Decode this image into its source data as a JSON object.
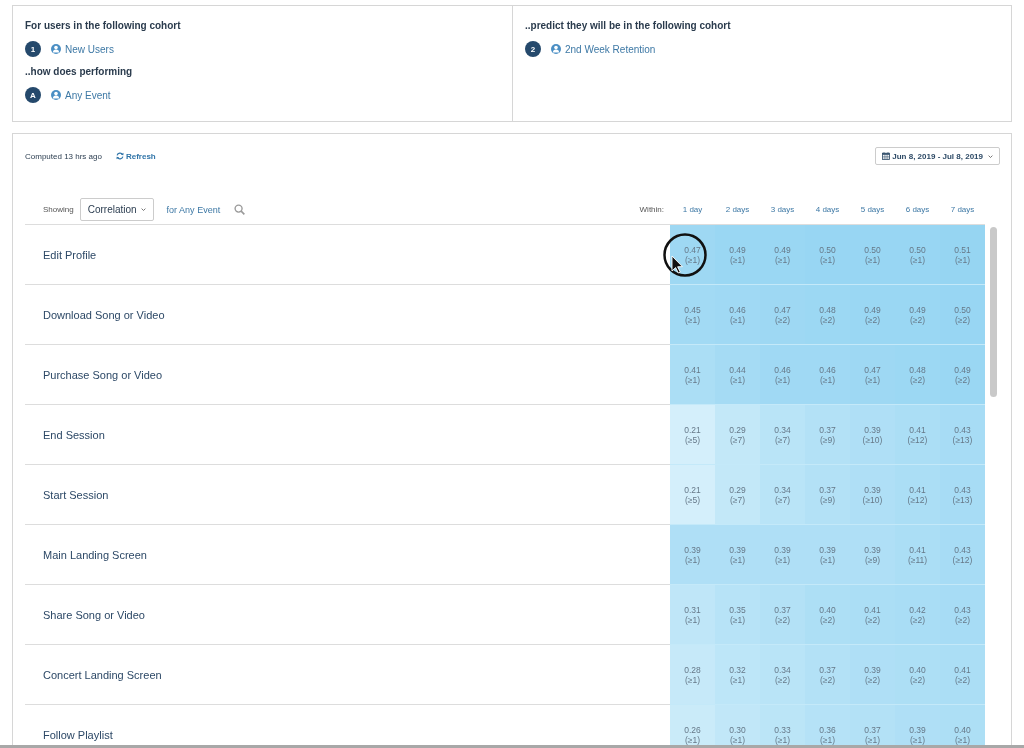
{
  "query": {
    "panes": [
      {
        "steps": [
          {
            "label": "For users in the following cohort",
            "badge": "1",
            "item": "New Users"
          },
          {
            "label": "..how does performing",
            "badge": "A",
            "item": "Any Event"
          }
        ]
      },
      {
        "steps": [
          {
            "label": "..predict they will be in the following cohort",
            "badge": "2",
            "item": "2nd Week Retention"
          }
        ]
      }
    ]
  },
  "results": {
    "computed": "Computed 13 hrs ago",
    "refresh": "Refresh",
    "date_range": "Jun 8, 2019 - Jul 8, 2019",
    "showing_label": "Showing",
    "metric": "Correlation",
    "event_filter": "for Any Event",
    "within_label": "Within:",
    "columns": [
      "1 day",
      "2 days",
      "3 days",
      "4 days",
      "5 days",
      "6 days",
      "7 days"
    ],
    "rows": [
      {
        "event": "Edit Profile",
        "cells": [
          {
            "value": "0.47",
            "count": "(≥1)"
          },
          {
            "value": "0.49",
            "count": "(≥1)"
          },
          {
            "value": "0.49",
            "count": "(≥1)"
          },
          {
            "value": "0.50",
            "count": "(≥1)"
          },
          {
            "value": "0.50",
            "count": "(≥1)"
          },
          {
            "value": "0.50",
            "count": "(≥1)"
          },
          {
            "value": "0.51",
            "count": "(≥1)"
          }
        ]
      },
      {
        "event": "Download Song or Video",
        "cells": [
          {
            "value": "0.45",
            "count": "(≥1)"
          },
          {
            "value": "0.46",
            "count": "(≥1)"
          },
          {
            "value": "0.47",
            "count": "(≥2)"
          },
          {
            "value": "0.48",
            "count": "(≥2)"
          },
          {
            "value": "0.49",
            "count": "(≥2)"
          },
          {
            "value": "0.49",
            "count": "(≥2)"
          },
          {
            "value": "0.50",
            "count": "(≥2)"
          }
        ]
      },
      {
        "event": "Purchase Song or Video",
        "cells": [
          {
            "value": "0.41",
            "count": "(≥1)"
          },
          {
            "value": "0.44",
            "count": "(≥1)"
          },
          {
            "value": "0.46",
            "count": "(≥1)"
          },
          {
            "value": "0.46",
            "count": "(≥1)"
          },
          {
            "value": "0.47",
            "count": "(≥1)"
          },
          {
            "value": "0.48",
            "count": "(≥2)"
          },
          {
            "value": "0.49",
            "count": "(≥2)"
          }
        ]
      },
      {
        "event": "End Session",
        "cells": [
          {
            "value": "0.21",
            "count": "(≥5)"
          },
          {
            "value": "0.29",
            "count": "(≥7)"
          },
          {
            "value": "0.34",
            "count": "(≥7)"
          },
          {
            "value": "0.37",
            "count": "(≥9)"
          },
          {
            "value": "0.39",
            "count": "(≥10)"
          },
          {
            "value": "0.41",
            "count": "(≥12)"
          },
          {
            "value": "0.43",
            "count": "(≥13)"
          }
        ]
      },
      {
        "event": "Start Session",
        "cells": [
          {
            "value": "0.21",
            "count": "(≥5)"
          },
          {
            "value": "0.29",
            "count": "(≥7)"
          },
          {
            "value": "0.34",
            "count": "(≥7)"
          },
          {
            "value": "0.37",
            "count": "(≥9)"
          },
          {
            "value": "0.39",
            "count": "(≥10)"
          },
          {
            "value": "0.41",
            "count": "(≥12)"
          },
          {
            "value": "0.43",
            "count": "(≥13)"
          }
        ]
      },
      {
        "event": "Main Landing Screen",
        "cells": [
          {
            "value": "0.39",
            "count": "(≥1)"
          },
          {
            "value": "0.39",
            "count": "(≥1)"
          },
          {
            "value": "0.39",
            "count": "(≥1)"
          },
          {
            "value": "0.39",
            "count": "(≥1)"
          },
          {
            "value": "0.39",
            "count": "(≥9)"
          },
          {
            "value": "0.41",
            "count": "(≥11)"
          },
          {
            "value": "0.43",
            "count": "(≥12)"
          }
        ]
      },
      {
        "event": "Share Song or Video",
        "cells": [
          {
            "value": "0.31",
            "count": "(≥1)"
          },
          {
            "value": "0.35",
            "count": "(≥1)"
          },
          {
            "value": "0.37",
            "count": "(≥2)"
          },
          {
            "value": "0.40",
            "count": "(≥2)"
          },
          {
            "value": "0.41",
            "count": "(≥2)"
          },
          {
            "value": "0.42",
            "count": "(≥2)"
          },
          {
            "value": "0.43",
            "count": "(≥2)"
          }
        ]
      },
      {
        "event": "Concert Landing Screen",
        "cells": [
          {
            "value": "0.28",
            "count": "(≥1)"
          },
          {
            "value": "0.32",
            "count": "(≥1)"
          },
          {
            "value": "0.34",
            "count": "(≥2)"
          },
          {
            "value": "0.37",
            "count": "(≥2)"
          },
          {
            "value": "0.39",
            "count": "(≥2)"
          },
          {
            "value": "0.40",
            "count": "(≥2)"
          },
          {
            "value": "0.41",
            "count": "(≥2)"
          }
        ]
      },
      {
        "event": "Follow Playlist",
        "cells": [
          {
            "value": "0.26",
            "count": "(≥1)"
          },
          {
            "value": "0.30",
            "count": "(≥1)"
          },
          {
            "value": "0.33",
            "count": "(≥1)"
          },
          {
            "value": "0.36",
            "count": "(≥1)"
          },
          {
            "value": "0.37",
            "count": "(≥1)"
          },
          {
            "value": "0.39",
            "count": "(≥1)"
          },
          {
            "value": "0.40",
            "count": "(≥1)"
          }
        ]
      }
    ]
  }
}
